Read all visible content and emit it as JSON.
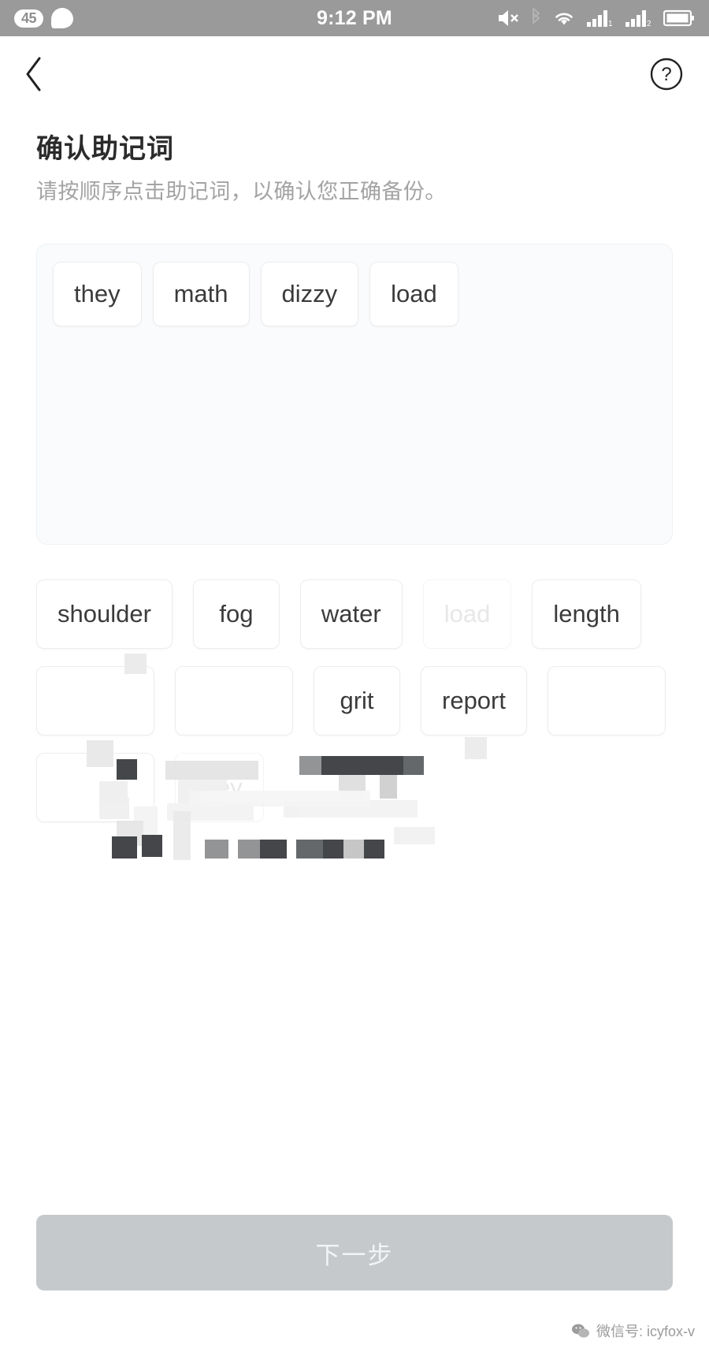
{
  "status_bar": {
    "badge_count": "45",
    "time": "9:12 PM",
    "icons": [
      "chat-bubble-icon",
      "volume-mute-icon",
      "bluetooth-icon",
      "wifi-icon",
      "cellular-signal-1-icon",
      "cellular-signal-2-icon",
      "battery-icon"
    ],
    "background_color": "#9a9a9a"
  },
  "nav": {
    "back_icon": "chevron-left-icon",
    "help_icon": "question-mark-circle-icon"
  },
  "header": {
    "title": "确认助记词",
    "subtitle": "请按顺序点击助记词，以确认您正确备份。"
  },
  "selected_words": [
    {
      "label": "they"
    },
    {
      "label": "math"
    },
    {
      "label": "dizzy"
    },
    {
      "label": "load"
    }
  ],
  "word_bank": [
    {
      "label": "shoulder",
      "used": false
    },
    {
      "label": "fog",
      "used": false
    },
    {
      "label": "water",
      "used": false
    },
    {
      "label": "load",
      "used": true
    },
    {
      "label": "length",
      "used": false
    },
    {
      "label": "",
      "used": false
    },
    {
      "label": "",
      "used": false
    },
    {
      "label": "grit",
      "used": false
    },
    {
      "label": "report",
      "used": false
    },
    {
      "label": "",
      "used": false
    },
    {
      "label": "",
      "used": false
    },
    {
      "label": "they",
      "used": true
    }
  ],
  "footer": {
    "next_label": "下一步",
    "next_enabled": false,
    "next_color": "#c6c9cb"
  },
  "watermark": {
    "text": "微信号: icyfox-v",
    "icon": "wechat-icon"
  },
  "colors": {
    "page_bg": "#ffffff",
    "panel_bg": "#fafbfc",
    "chip_border": "#ededed",
    "text_primary": "#2b2b2b",
    "text_secondary": "#a3a3a3",
    "text_disabled": "#e7e7e7"
  }
}
